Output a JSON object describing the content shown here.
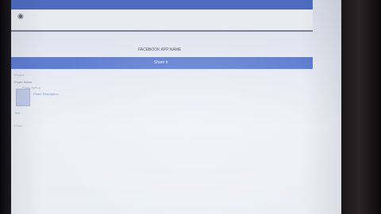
{
  "page": {
    "caption": "FACEBOOK APP NAME",
    "header": "Share it",
    "small_lines": [
      "Photos",
      "Photo Name",
      "Photo Author",
      "Photo Description",
      "Title",
      "Photo"
    ]
  }
}
